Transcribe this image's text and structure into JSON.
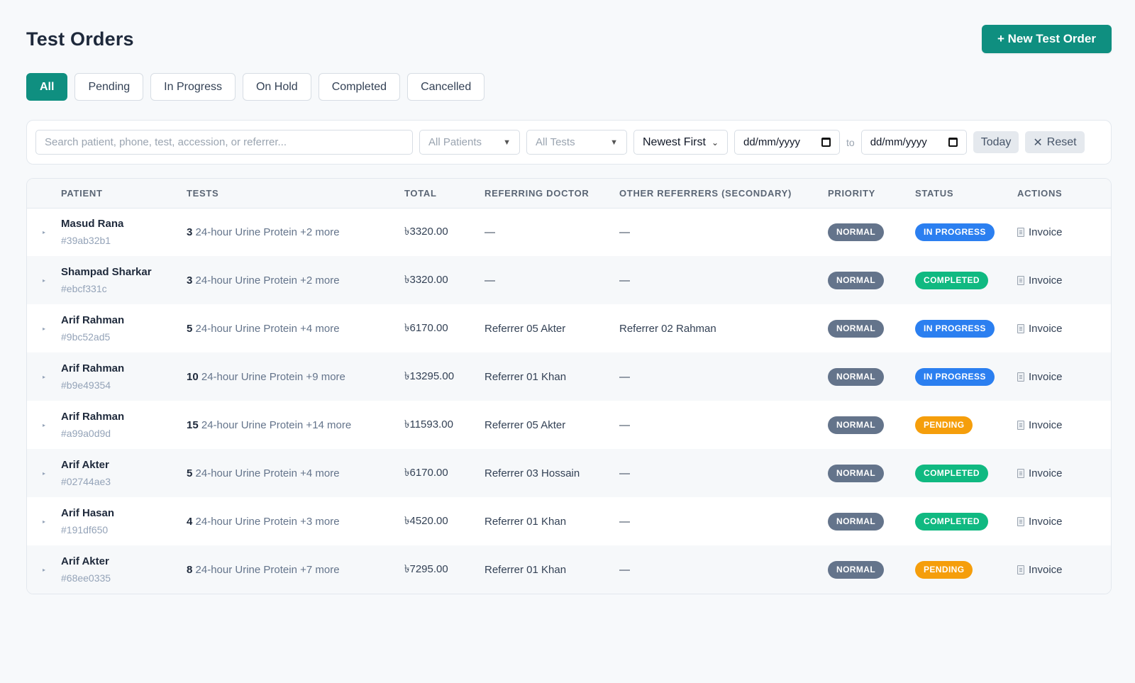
{
  "header": {
    "title": "Test Orders",
    "new_button": "+ New Test Order"
  },
  "tabs": [
    {
      "label": "All",
      "active": true
    },
    {
      "label": "Pending"
    },
    {
      "label": "In Progress"
    },
    {
      "label": "On Hold"
    },
    {
      "label": "Completed"
    },
    {
      "label": "Cancelled"
    }
  ],
  "filters": {
    "search_placeholder": "Search patient, phone, test, accession, or referrer...",
    "patients": "All Patients",
    "tests": "All Tests",
    "sort": "Newest First",
    "date_from": "dd/mm/yyyy",
    "to": "to",
    "date_to": "dd/mm/yyyy",
    "today": "Today",
    "reset": "Reset"
  },
  "table": {
    "headers": [
      "PATIENT",
      "TESTS",
      "TOTAL",
      "REFERRING DOCTOR",
      "OTHER REFERRERS (SECONDARY)",
      "PRIORITY",
      "STATUS",
      "ACTIONS"
    ],
    "rows": [
      {
        "name": "Masud Rana",
        "id": "#39ab32b1",
        "count": "3",
        "tests": "24-hour Urine Protein +2 more",
        "total": "৳3320.00",
        "doctor": "—",
        "secondary": "—",
        "priority": "NORMAL",
        "status": "IN PROGRESS",
        "status_key": "progress",
        "action": "Invoice"
      },
      {
        "name": "Shampad Sharkar",
        "id": "#ebcf331c",
        "count": "3",
        "tests": "24-hour Urine Protein +2 more",
        "total": "৳3320.00",
        "doctor": "—",
        "secondary": "—",
        "priority": "NORMAL",
        "status": "COMPLETED",
        "status_key": "completed",
        "action": "Invoice"
      },
      {
        "name": "Arif Rahman",
        "id": "#9bc52ad5",
        "count": "5",
        "tests": "24-hour Urine Protein +4 more",
        "total": "৳6170.00",
        "doctor": "Referrer 05 Akter",
        "secondary": "Referrer 02 Rahman",
        "priority": "NORMAL",
        "status": "IN PROGRESS",
        "status_key": "progress",
        "action": "Invoice"
      },
      {
        "name": "Arif Rahman",
        "id": "#b9e49354",
        "count": "10",
        "tests": "24-hour Urine Protein +9 more",
        "total": "৳13295.00",
        "doctor": "Referrer 01 Khan",
        "secondary": "—",
        "priority": "NORMAL",
        "status": "IN PROGRESS",
        "status_key": "progress",
        "action": "Invoice"
      },
      {
        "name": "Arif Rahman",
        "id": "#a99a0d9d",
        "count": "15",
        "tests": "24-hour Urine Protein +14 more",
        "total": "৳11593.00",
        "doctor": "Referrer 05 Akter",
        "secondary": "—",
        "priority": "NORMAL",
        "status": "PENDING",
        "status_key": "pending",
        "action": "Invoice"
      },
      {
        "name": "Arif Akter",
        "id": "#02744ae3",
        "count": "5",
        "tests": "24-hour Urine Protein +4 more",
        "total": "৳6170.00",
        "doctor": "Referrer 03 Hossain",
        "secondary": "—",
        "priority": "NORMAL",
        "status": "COMPLETED",
        "status_key": "completed",
        "action": "Invoice"
      },
      {
        "name": "Arif Hasan",
        "id": "#191df650",
        "count": "4",
        "tests": "24-hour Urine Protein +3 more",
        "total": "৳4520.00",
        "doctor": "Referrer 01 Khan",
        "secondary": "—",
        "priority": "NORMAL",
        "status": "COMPLETED",
        "status_key": "completed",
        "action": "Invoice"
      },
      {
        "name": "Arif Akter",
        "id": "#68ee0335",
        "count": "8",
        "tests": "24-hour Urine Protein +7 more",
        "total": "৳7295.00",
        "doctor": "Referrer 01 Khan",
        "secondary": "—",
        "priority": "NORMAL",
        "status": "PENDING",
        "status_key": "pending",
        "action": "Invoice"
      }
    ]
  }
}
